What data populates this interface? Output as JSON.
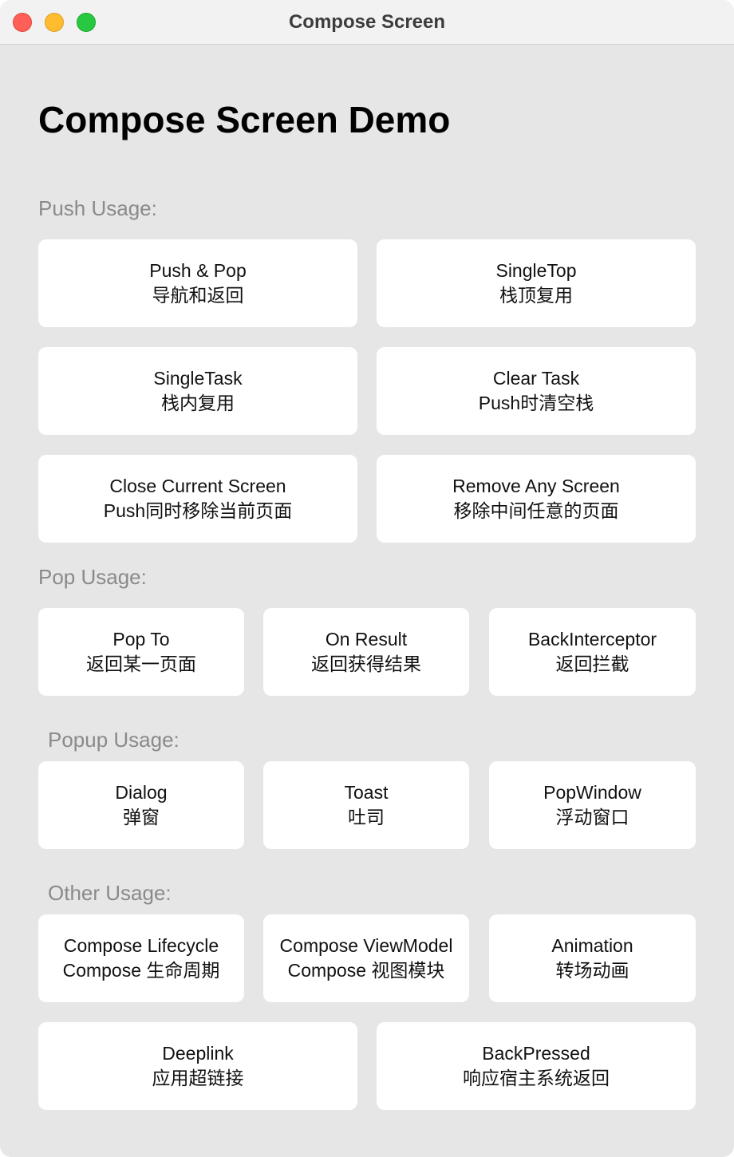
{
  "window": {
    "title": "Compose Screen"
  },
  "page": {
    "title": "Compose Screen Demo"
  },
  "sections": {
    "push": {
      "label": "Push Usage:",
      "buttons": [
        {
          "line1": "Push & Pop",
          "line2": "导航和返回"
        },
        {
          "line1": "SingleTop",
          "line2": "栈顶复用"
        },
        {
          "line1": "SingleTask",
          "line2": "栈内复用"
        },
        {
          "line1": "Clear Task",
          "line2": "Push时清空栈"
        },
        {
          "line1": "Close Current Screen",
          "line2": "Push同时移除当前页面"
        },
        {
          "line1": "Remove Any Screen",
          "line2": "移除中间任意的页面"
        }
      ]
    },
    "pop": {
      "label": "Pop Usage:",
      "buttons": [
        {
          "line1": "Pop To",
          "line2": "返回某一页面"
        },
        {
          "line1": "On Result",
          "line2": "返回获得结果"
        },
        {
          "line1": "BackInterceptor",
          "line2": "返回拦截"
        }
      ]
    },
    "popup": {
      "label": "Popup Usage:",
      "buttons": [
        {
          "line1": "Dialog",
          "line2": "弹窗"
        },
        {
          "line1": "Toast",
          "line2": "吐司"
        },
        {
          "line1": "PopWindow",
          "line2": "浮动窗口"
        }
      ]
    },
    "other": {
      "label": "Other Usage:",
      "buttons": [
        {
          "line1": "Compose Lifecycle",
          "line2": "Compose 生命周期"
        },
        {
          "line1": "Compose ViewModel",
          "line2": "Compose 视图模块"
        },
        {
          "line1": "Animation",
          "line2": "转场动画"
        },
        {
          "line1": "Deeplink",
          "line2": "应用超链接"
        },
        {
          "line1": "BackPressed",
          "line2": "响应宿主系统返回"
        }
      ]
    }
  }
}
